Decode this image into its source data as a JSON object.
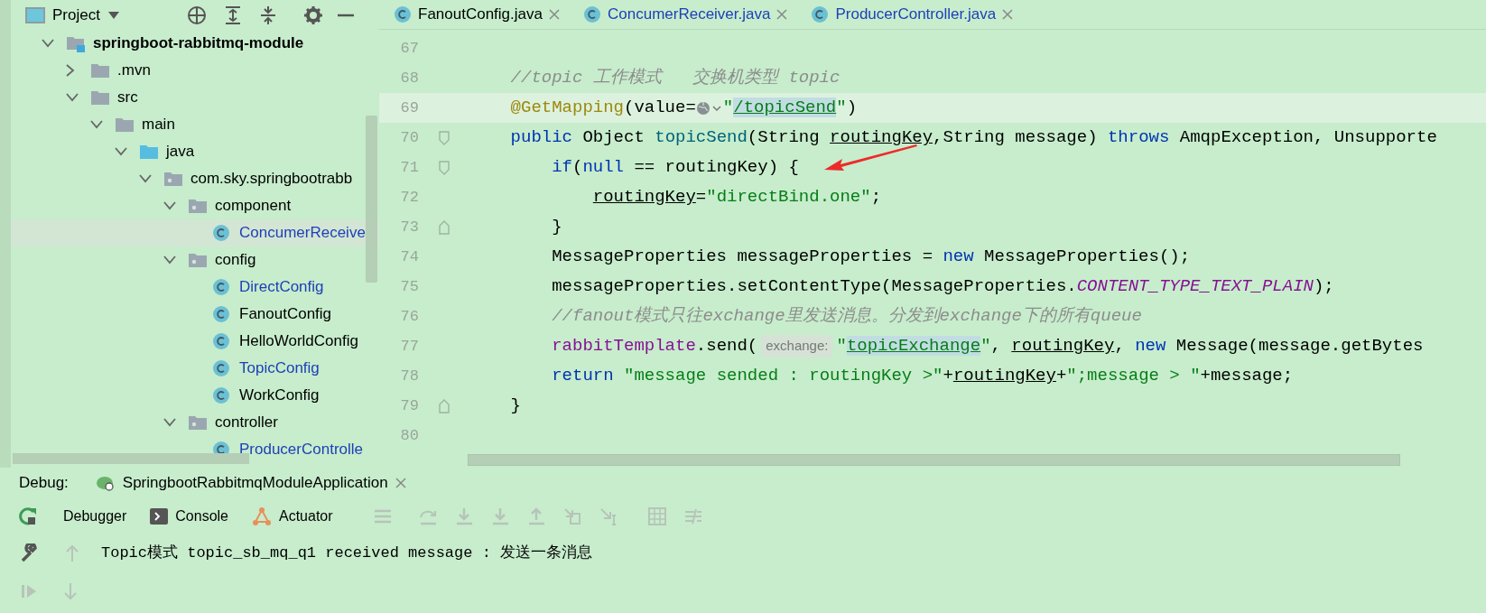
{
  "project_panel": {
    "title": "Project",
    "tree": [
      {
        "label": "springboot-rabbitmq-module",
        "kind": "module",
        "expanded": true,
        "selected": false,
        "children": [
          {
            "label": ".mvn",
            "kind": "folder",
            "expanded": false,
            "selected": false
          },
          {
            "label": "src",
            "kind": "folder",
            "expanded": true,
            "selected": false,
            "children": [
              {
                "label": "main",
                "kind": "folder",
                "expanded": true,
                "selected": false,
                "children": [
                  {
                    "label": "java",
                    "kind": "source",
                    "expanded": true,
                    "selected": false,
                    "children": [
                      {
                        "label": "com.sky.springbootrabb",
                        "kind": "package",
                        "expanded": true,
                        "selected": false,
                        "children": [
                          {
                            "label": "component",
                            "kind": "package",
                            "expanded": true,
                            "selected": false,
                            "children": [
                              {
                                "label": "ConcumerReceive",
                                "kind": "class",
                                "modified": true,
                                "selected": true
                              }
                            ]
                          },
                          {
                            "label": "config",
                            "kind": "package",
                            "expanded": true,
                            "selected": false,
                            "children": [
                              {
                                "label": "DirectConfig",
                                "kind": "class",
                                "modified": true,
                                "selected": false
                              },
                              {
                                "label": "FanoutConfig",
                                "kind": "class",
                                "modified": false,
                                "selected": false
                              },
                              {
                                "label": "HelloWorldConfig",
                                "kind": "class",
                                "modified": false,
                                "selected": false
                              },
                              {
                                "label": "TopicConfig",
                                "kind": "class",
                                "modified": true,
                                "selected": false
                              },
                              {
                                "label": "WorkConfig",
                                "kind": "class",
                                "modified": false,
                                "selected": false
                              }
                            ]
                          },
                          {
                            "label": "controller",
                            "kind": "package",
                            "expanded": true,
                            "selected": false,
                            "children": [
                              {
                                "label": "ProducerControlle",
                                "kind": "class",
                                "modified": true,
                                "selected": false
                              }
                            ]
                          }
                        ]
                      }
                    ]
                  }
                ]
              }
            ]
          }
        ]
      }
    ]
  },
  "editor_tabs": [
    {
      "label": "FanoutConfig.java",
      "modified": false
    },
    {
      "label": "ConcumerReceiver.java",
      "modified": true
    },
    {
      "label": "ProducerController.java",
      "modified": true
    }
  ],
  "code_lines": [
    {
      "number": "67",
      "current": false
    },
    {
      "number": "68",
      "current": false,
      "tokens": [
        {
          "kind": "comment",
          "text": "//topic 工作模式   交换机类型 topic"
        }
      ]
    },
    {
      "number": "69",
      "current": true,
      "tokens": [
        {
          "kind": "annotation",
          "text": "@GetMapping"
        },
        {
          "kind": "plain",
          "text": "(value="
        },
        {
          "kind": "globe"
        },
        {
          "kind": "string",
          "text": "\""
        },
        {
          "kind": "link",
          "text": "/topicSend"
        },
        {
          "kind": "string",
          "text": "\""
        },
        {
          "kind": "plain",
          "text": ")"
        }
      ]
    },
    {
      "number": "70",
      "current": false,
      "tokens": [
        {
          "kind": "keyword",
          "text": "public"
        },
        {
          "kind": "plain",
          "text": " Object "
        },
        {
          "kind": "method",
          "text": "topicSend"
        },
        {
          "kind": "plain",
          "text": "(String "
        },
        {
          "kind": "param",
          "text": "routingKey"
        },
        {
          "kind": "plain",
          "text": ",String message) "
        },
        {
          "kind": "keyword",
          "text": "throws"
        },
        {
          "kind": "plain",
          "text": " AmqpException, Unsupporte"
        }
      ],
      "children": [
        {
          "number": "71",
          "current": false,
          "tokens": [
            {
              "kind": "keyword",
              "text": "if"
            },
            {
              "kind": "plain",
              "text": "("
            },
            {
              "kind": "keyword",
              "text": "null"
            },
            {
              "kind": "plain",
              "text": " == routingKey) {"
            }
          ],
          "children": [
            {
              "number": "72",
              "current": false,
              "tokens": [
                {
                  "kind": "param",
                  "text": "routingKey"
                },
                {
                  "kind": "plain",
                  "text": "="
                },
                {
                  "kind": "string",
                  "text": "\"directBind.one\""
                },
                {
                  "kind": "plain",
                  "text": ";"
                }
              ]
            }
          ]
        },
        {
          "number": "73",
          "current": false,
          "tokens": [
            {
              "kind": "plain",
              "text": "}"
            }
          ]
        },
        {
          "number": "74",
          "current": false,
          "tokens": [
            {
              "kind": "plain",
              "text": "MessageProperties messageProperties = "
            },
            {
              "kind": "keyword",
              "text": "new"
            },
            {
              "kind": "plain",
              "text": " MessageProperties();"
            }
          ]
        },
        {
          "number": "75",
          "current": false,
          "tokens": [
            {
              "kind": "plain",
              "text": "messageProperties.setContentType(MessageProperties."
            },
            {
              "kind": "constant",
              "text": "CONTENT_TYPE_TEXT_PLAIN"
            },
            {
              "kind": "plain",
              "text": ");"
            }
          ]
        },
        {
          "number": "76",
          "current": false,
          "tokens": [
            {
              "kind": "comment",
              "text": "//fanout模式只往exchange里发送消息。分发到exchange下的所有queue"
            }
          ]
        },
        {
          "number": "77",
          "current": false,
          "tokens": [
            {
              "kind": "field",
              "text": "rabbitTemplate"
            },
            {
              "kind": "plain",
              "text": ".send("
            },
            {
              "kind": "hint",
              "text": "exchange:"
            },
            {
              "kind": "string",
              "text": "\""
            },
            {
              "kind": "link",
              "text": "topicExchange"
            },
            {
              "kind": "string",
              "text": "\""
            },
            {
              "kind": "plain",
              "text": ", "
            },
            {
              "kind": "param",
              "text": "routingKey"
            },
            {
              "kind": "plain",
              "text": ", "
            },
            {
              "kind": "keyword",
              "text": "new"
            },
            {
              "kind": "plain",
              "text": " Message(message.getBytes"
            }
          ]
        },
        {
          "number": "78",
          "current": false,
          "tokens": [
            {
              "kind": "keyword",
              "text": "return"
            },
            {
              "kind": "string",
              "text": " \"message sended : routingKey >\""
            },
            {
              "kind": "plain",
              "text": "+"
            },
            {
              "kind": "param",
              "text": "routingKey"
            },
            {
              "kind": "plain",
              "text": "+"
            },
            {
              "kind": "string",
              "text": "\";message > \""
            },
            {
              "kind": "plain",
              "text": "+message;"
            }
          ]
        }
      ]
    },
    {
      "number": "79",
      "current": false,
      "tokens": [
        {
          "kind": "plain",
          "text": "}"
        }
      ]
    },
    {
      "number": "80",
      "current": false
    }
  ],
  "debug_panel": {
    "label": "Debug:",
    "session": "SpringbootRabbitmqModuleApplication",
    "tabs": [
      {
        "label": "Debugger",
        "kind": "debugger"
      },
      {
        "label": "Console",
        "kind": "console"
      },
      {
        "label": "Actuator",
        "kind": "actuator"
      }
    ],
    "output": "Topic模式 topic_sb_mq_q1 received message : 发送一条消息"
  }
}
